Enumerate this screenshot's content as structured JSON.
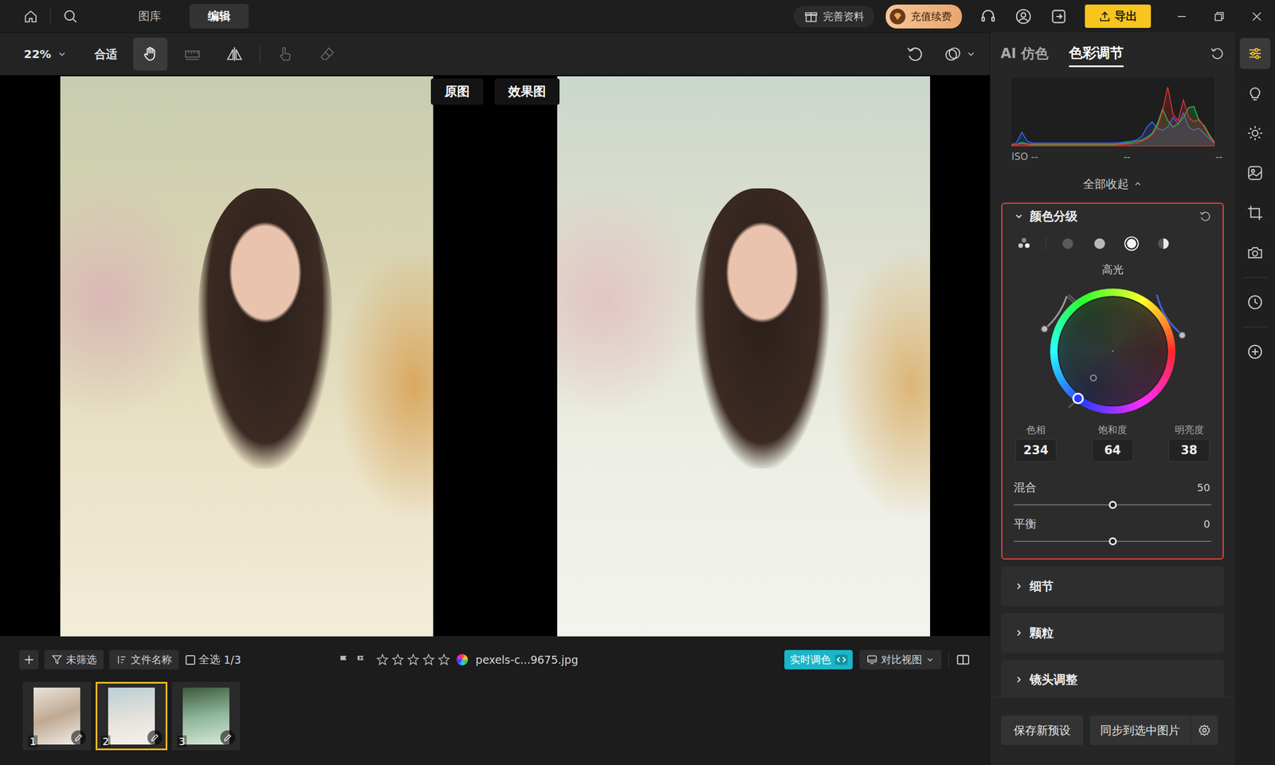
{
  "topbar": {
    "tabs": [
      {
        "label": "图库",
        "selected": false
      },
      {
        "label": "编辑",
        "selected": true
      }
    ],
    "profile": "完善资料",
    "recharge": "充值续费",
    "export": "导出"
  },
  "toolbar": {
    "zoom": "22%",
    "fit": "合适",
    "tools": [
      {
        "selected": true,
        "disabled": false
      },
      {
        "selected": false,
        "disabled": true
      },
      {
        "selected": false,
        "disabled": false
      },
      {
        "selected": false,
        "disabled": true
      },
      {
        "selected": false,
        "disabled": true
      }
    ]
  },
  "canvas": {
    "labels": [
      "原图",
      "效果图"
    ]
  },
  "filmstrip": {
    "filter": "未筛选",
    "sort": "文件名称",
    "select_all": {
      "label": "全选",
      "checked": false
    },
    "count": "1/3",
    "stars": 0,
    "filename": "pexels-c...9675.jpg",
    "realtime": {
      "label": "实时调色",
      "on": true
    },
    "view": "对比视图",
    "thumbnails": [
      {
        "number": "1",
        "selected": false
      },
      {
        "number": "2",
        "selected": true
      },
      {
        "number": "3",
        "selected": false
      }
    ]
  },
  "panel": {
    "tabs": [
      {
        "label": "AI 仿色",
        "selected": false
      },
      {
        "label": "色彩调节",
        "selected": true
      }
    ],
    "histogram": {
      "red": [
        2,
        3,
        4,
        3,
        2,
        2,
        2,
        2,
        2,
        2,
        2,
        2,
        2,
        2,
        2,
        2,
        2,
        2,
        2,
        2,
        2,
        3,
        3,
        4,
        5,
        8,
        12,
        18,
        30,
        55,
        92,
        50,
        40,
        72,
        45,
        38,
        42,
        30,
        15,
        5
      ],
      "green": [
        2,
        3,
        6,
        4,
        3,
        3,
        3,
        3,
        3,
        3,
        3,
        3,
        3,
        3,
        3,
        3,
        3,
        3,
        3,
        3,
        3,
        4,
        5,
        6,
        8,
        10,
        14,
        20,
        35,
        58,
        40,
        30,
        35,
        45,
        60,
        62,
        40,
        32,
        18,
        6
      ],
      "blue": [
        3,
        6,
        22,
        8,
        5,
        5,
        5,
        5,
        5,
        5,
        5,
        5,
        5,
        5,
        5,
        5,
        5,
        5,
        5,
        5,
        5,
        6,
        7,
        8,
        10,
        15,
        30,
        38,
        28,
        25,
        30,
        45,
        35,
        52,
        30,
        25,
        28,
        20,
        12,
        4
      ],
      "readouts": [
        "ISO --",
        "--",
        "--"
      ]
    },
    "collapse_all": "全部收起",
    "color_grading": {
      "title": "颜色分级",
      "expanded": true,
      "modes": [
        {
          "selected": false
        },
        {
          "selected": false
        },
        {
          "selected": false
        },
        {
          "selected": true
        },
        {
          "selected": false
        }
      ],
      "mode_label": "高光",
      "hue": {
        "label": "色相",
        "value": "234"
      },
      "saturation": {
        "label": "饱和度",
        "value": "64"
      },
      "brightness": {
        "label": "明亮度",
        "value": "38"
      },
      "sliders": [
        {
          "label": "混合",
          "value": "50",
          "level": 0.5
        },
        {
          "label": "平衡",
          "value": "0",
          "level": 0.5
        }
      ]
    },
    "sections": [
      {
        "title": "细节",
        "expanded": false
      },
      {
        "title": "颗粒",
        "expanded": false
      },
      {
        "title": "镜头调整",
        "expanded": false
      }
    ],
    "footer": {
      "save": "保存新预设",
      "sync": "同步到选中图片"
    }
  },
  "rail": [
    {
      "selected": true
    },
    {
      "selected": false
    },
    {
      "selected": false
    },
    {
      "selected": false
    },
    {
      "selected": false
    },
    {
      "selected": false
    },
    {
      "selected": false
    },
    {
      "selected": false
    }
  ]
}
